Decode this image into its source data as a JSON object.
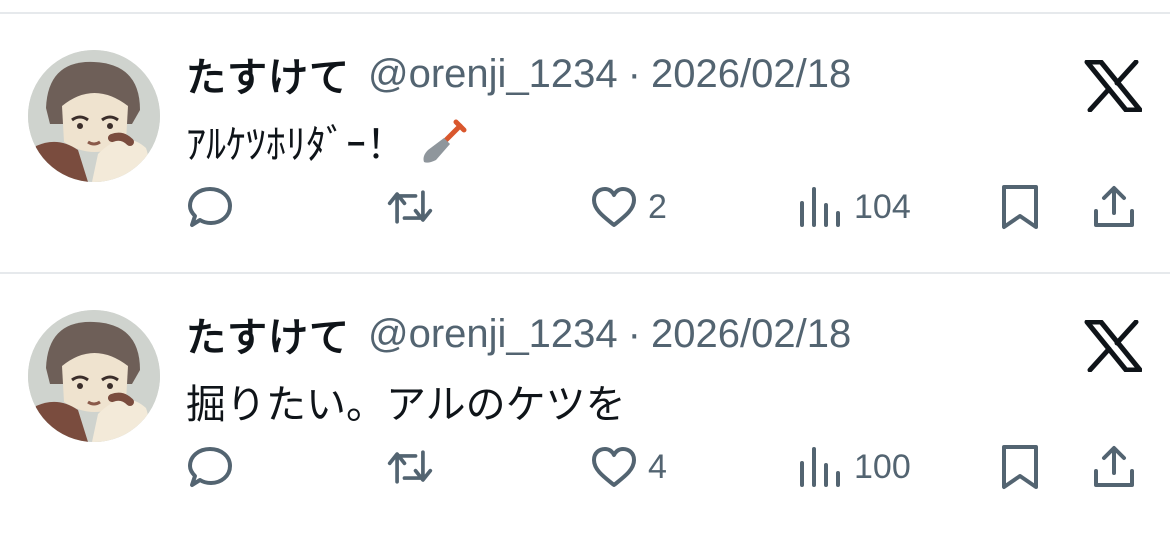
{
  "colors": {
    "text": "#0f1419",
    "secondary": "#536471",
    "divider": "#e6e9ec"
  },
  "tweets": [
    {
      "name": "たすけて",
      "handle": "@orenji_1234",
      "separator": "·",
      "date": "2026/02/18",
      "text": "ｱﾙｹﾂﾎﾘﾀﾞｰ！",
      "emoji": "shovel-emoji",
      "replies": "",
      "retweets": "",
      "likes": "2",
      "views": "104"
    },
    {
      "name": "たすけて",
      "handle": "@orenji_1234",
      "separator": "·",
      "date": "2026/02/18",
      "text": "掘りたい。アルのケツを",
      "replies": "",
      "retweets": "",
      "likes": "4",
      "views": "100"
    }
  ]
}
